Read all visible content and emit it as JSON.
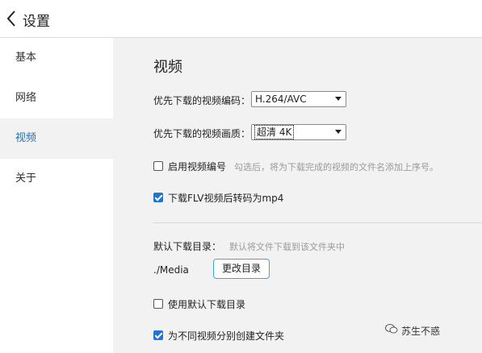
{
  "header": {
    "title": "设置"
  },
  "sidebar": {
    "items": [
      {
        "label": "基本"
      },
      {
        "label": "网络"
      },
      {
        "label": "视频"
      },
      {
        "label": "关于"
      }
    ]
  },
  "main": {
    "section_title": "视频",
    "codec": {
      "label": "优先下载的视频编码：",
      "value": "H.264/AVC"
    },
    "quality": {
      "label": "优先下载的视频画质：",
      "value": "超清 4K"
    },
    "numbering": {
      "label": "启用视频编号",
      "hint": "勾选后，将为下载完成的视频的文件名添加上序号。",
      "checked": false
    },
    "flv": {
      "label": "下载FLV视频后转码为mp4",
      "checked": true
    },
    "download_dir": {
      "label": "默认下载目录：",
      "hint": "默认将文件下载到该文件夹中",
      "path": "./Media",
      "change_button": "更改目录"
    },
    "use_default_dir": {
      "label": "使用默认下载目录",
      "checked": false
    },
    "create_folders": {
      "label": "为不同视频分别创建文件夹",
      "checked": true
    }
  },
  "watermark": {
    "text": "苏生不惑"
  },
  "colors": {
    "accent": "#1f74d4",
    "panel_bg": "#f2f2f2",
    "active_nav": "#1a73c8"
  }
}
